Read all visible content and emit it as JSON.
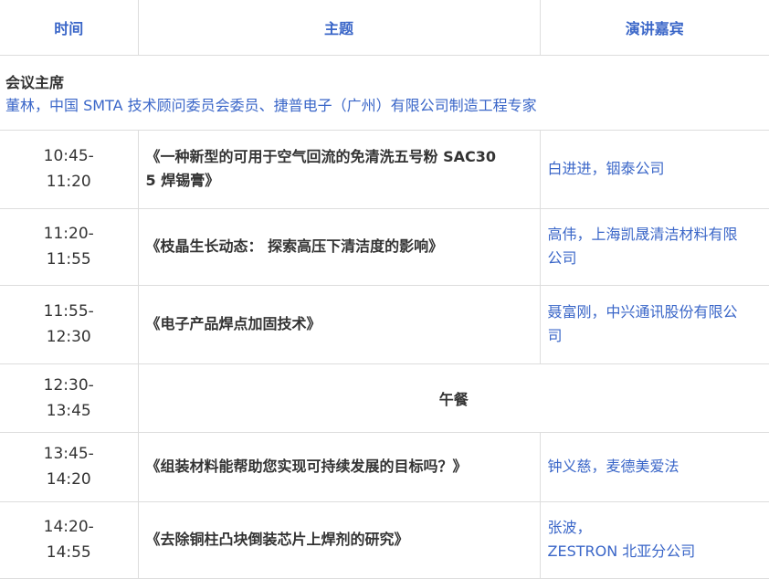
{
  "header": {
    "time": "时间",
    "topic": "主题",
    "speaker": "演讲嘉宾"
  },
  "chair": {
    "label": "会议主席",
    "name": "董林，中国 SMTA 技术顾问委员会委员、捷普电子（广州）有限公司制造工程专家"
  },
  "sessions": [
    {
      "time_start": "10:45-",
      "time_end": "11:20",
      "topic_line1": "《一种新型的可用于空气回流的免清洗五号粉 SAC30",
      "topic_line2": "5 焊锡膏》",
      "speaker_line1": "白进进，铟泰公司",
      "speaker_line2": ""
    },
    {
      "time_start": "11:20-",
      "time_end": "11:55",
      "topic_line1": "《枝晶生长动态： 探索高压下清洁度的影响》",
      "topic_line2": "",
      "speaker_line1": "高伟，上海凯晟清洁材料有限",
      "speaker_line2": "公司"
    },
    {
      "time_start": "11:55-",
      "time_end": "12:30",
      "topic_line1": "《电子产品焊点加固技术》",
      "topic_line2": "",
      "speaker_line1": "聂富刚，中兴通讯股份有限公",
      "speaker_line2": "司"
    },
    {
      "time_start": "12:30-",
      "time_end": "13:45",
      "lunch": "午餐"
    },
    {
      "time_start": "13:45-",
      "time_end": "14:20",
      "topic_line1": "《组装材料能帮助您实现可持续发展的目标吗？》",
      "topic_line2": "",
      "speaker_line1": "钟义慈，麦德美爱法",
      "speaker_line2": ""
    },
    {
      "time_start": "14:20-",
      "time_end": "14:55",
      "topic_line1": "《去除铜柱凸块倒装芯片上焊剂的研究》",
      "topic_line2": "",
      "speaker_line1": "张波，",
      "speaker_line2": "ZESTRON 北亚分公司"
    }
  ]
}
